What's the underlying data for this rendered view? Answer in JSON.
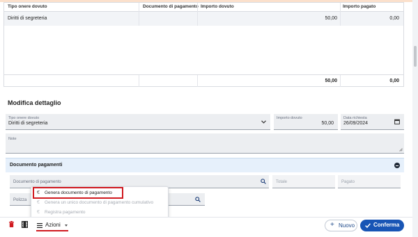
{
  "table": {
    "headers": [
      "Tipo onere dovuto",
      "Documento di pagamento",
      "Importo dovuto",
      "Importo pagato"
    ],
    "rows": [
      {
        "tipo": "Diritti di segreteria",
        "documento": "",
        "importo_dovuto": "50,00",
        "importo_pagato": "0,00"
      }
    ],
    "totals": {
      "importo_dovuto": "50,00",
      "importo_pagato": "0,00"
    }
  },
  "detail": {
    "title": "Modifica dettaglio",
    "tipo_onere": {
      "label": "Tipo onere dovuto",
      "value": "Diritti di segreteria"
    },
    "importo": {
      "label": "Importo dovuto",
      "value": "50,00"
    },
    "data": {
      "label": "Data richiesta",
      "value": "26/09/2024"
    },
    "note": {
      "label": "Note"
    }
  },
  "documento_pagamenti": {
    "title": "Documento pagamenti",
    "documento_placeholder": "Documento di pagamento",
    "totale_placeholder": "Totale",
    "pagato_placeholder": "Pagato",
    "polizza_placeholder": "Polizza"
  },
  "menu": {
    "items": [
      {
        "label": "Genera documento di pagamento",
        "enabled": true
      },
      {
        "label": "Genera un unico documento di pagamento cumulativo",
        "enabled": false
      },
      {
        "label": "Registra pagamento",
        "enabled": false
      }
    ]
  },
  "footer": {
    "azioni_label": "Azioni",
    "nuovo_label": "Nuovo",
    "conferma_label": "Conferma"
  },
  "colors": {
    "accent": "#1855b5",
    "highlight": "#d0191f",
    "panel": "#e6f0fb"
  }
}
